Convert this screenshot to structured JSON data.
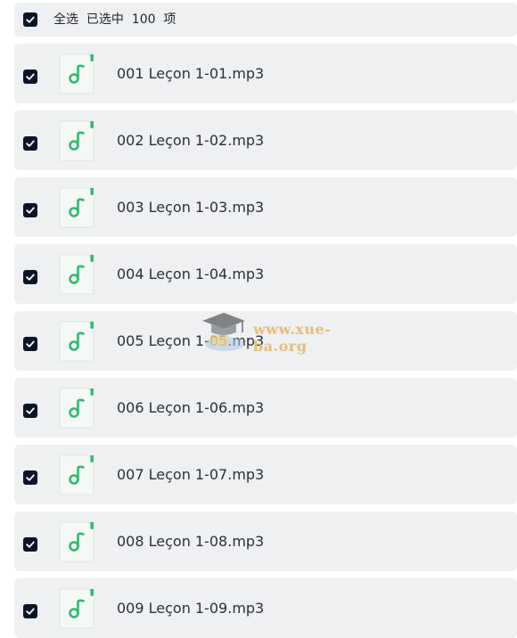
{
  "header": {
    "label": "全选  已选中  100  项",
    "checked": true
  },
  "files": [
    {
      "name": "001 Leçon 1-01.mp3",
      "checked": true
    },
    {
      "name": "002 Leçon 1-02.mp3",
      "checked": true
    },
    {
      "name": "003 Leçon 1-03.mp3",
      "checked": true
    },
    {
      "name": "004 Leçon 1-04.mp3",
      "checked": true
    },
    {
      "name": "005 Leçon 1-05.mp3",
      "checked": true
    },
    {
      "name": "006 Leçon 1-06.mp3",
      "checked": true
    },
    {
      "name": "007 Leçon 1-07.mp3",
      "checked": true
    },
    {
      "name": "008 Leçon 1-08.mp3",
      "checked": true
    },
    {
      "name": "009 Leçon 1-09.mp3",
      "checked": true
    }
  ],
  "file_icon": "music-note-file-icon",
  "watermark": {
    "text": "www.xue-ba.org",
    "icon": "graduation-cap-icon"
  },
  "colors": {
    "row_bg": "#eff0f2",
    "checkbox": "#0b1527",
    "music_icon": "#2fba6f",
    "watermark": "#e3b96a"
  }
}
